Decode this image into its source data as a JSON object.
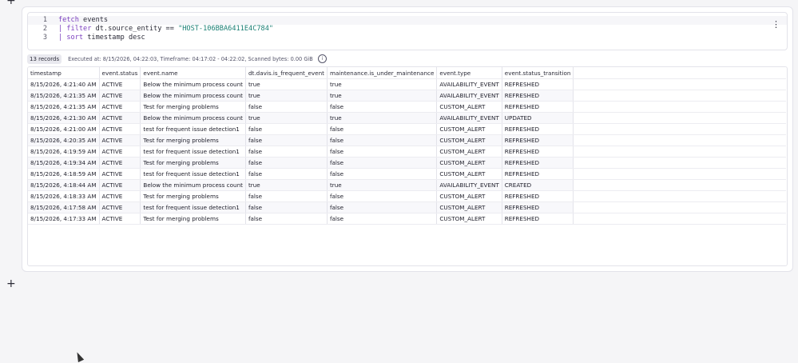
{
  "editor": {
    "lines": [
      {
        "num": "1",
        "kw": "fetch",
        "rest": " events"
      },
      {
        "num": "2",
        "pipe": "| ",
        "kw": "filter",
        "rest": " dt.source_entity == ",
        "str": "\"HOST-106BBA6411E4C784\""
      },
      {
        "num": "3",
        "pipe": "| ",
        "kw": "sort",
        "rest": " timestamp desc"
      }
    ]
  },
  "results": {
    "count_label": "13 records",
    "meta_text": "Executed at: 8/15/2026, 04:22:03, Timeframe: 04:17:02 - 04:22:02, Scanned bytes: 0.00 GiB"
  },
  "table": {
    "columns": [
      "timestamp",
      "event.status",
      "event.name",
      "dt.davis.is_frequent_event",
      "maintenance.is_under_maintenance",
      "event.type",
      "event.status_transition"
    ],
    "rows": [
      [
        "8/15/2026, 4:21:40 AM",
        "ACTIVE",
        "Below the minimum process count",
        "true",
        "true",
        "AVAILABILITY_EVENT",
        "REFRESHED"
      ],
      [
        "8/15/2026, 4:21:35 AM",
        "ACTIVE",
        "Below the minimum process count",
        "true",
        "true",
        "AVAILABILITY_EVENT",
        "REFRESHED"
      ],
      [
        "8/15/2026, 4:21:35 AM",
        "ACTIVE",
        "Test for merging problems",
        "false",
        "false",
        "CUSTOM_ALERT",
        "REFRESHED"
      ],
      [
        "8/15/2026, 4:21:30 AM",
        "ACTIVE",
        "Below the minimum process count",
        "true",
        "true",
        "AVAILABILITY_EVENT",
        "UPDATED"
      ],
      [
        "8/15/2026, 4:21:00 AM",
        "ACTIVE",
        "test for frequent issue detection1",
        "false",
        "false",
        "CUSTOM_ALERT",
        "REFRESHED"
      ],
      [
        "8/15/2026, 4:20:35 AM",
        "ACTIVE",
        "Test for merging problems",
        "false",
        "false",
        "CUSTOM_ALERT",
        "REFRESHED"
      ],
      [
        "8/15/2026, 4:19:59 AM",
        "ACTIVE",
        "test for frequent issue detection1",
        "false",
        "false",
        "CUSTOM_ALERT",
        "REFRESHED"
      ],
      [
        "8/15/2026, 4:19:34 AM",
        "ACTIVE",
        "Test for merging problems",
        "false",
        "false",
        "CUSTOM_ALERT",
        "REFRESHED"
      ],
      [
        "8/15/2026, 4:18:59 AM",
        "ACTIVE",
        "test for frequent issue detection1",
        "false",
        "false",
        "CUSTOM_ALERT",
        "REFRESHED"
      ],
      [
        "8/15/2026, 4:18:44 AM",
        "ACTIVE",
        "Below the minimum process count",
        "true",
        "true",
        "AVAILABILITY_EVENT",
        "CREATED"
      ],
      [
        "8/15/2026, 4:18:33 AM",
        "ACTIVE",
        "Test for merging problems",
        "false",
        "false",
        "CUSTOM_ALERT",
        "REFRESHED"
      ],
      [
        "8/15/2026, 4:17:58 AM",
        "ACTIVE",
        "test for frequent issue detection1",
        "false",
        "false",
        "CUSTOM_ALERT",
        "REFRESHED"
      ],
      [
        "8/15/2026, 4:17:33 AM",
        "ACTIVE",
        "Test for merging problems",
        "false",
        "false",
        "CUSTOM_ALERT",
        "REFRESHED"
      ]
    ]
  },
  "icons": {
    "add_top": "+",
    "add_bottom": "+",
    "more": "⋮",
    "info": "i"
  }
}
